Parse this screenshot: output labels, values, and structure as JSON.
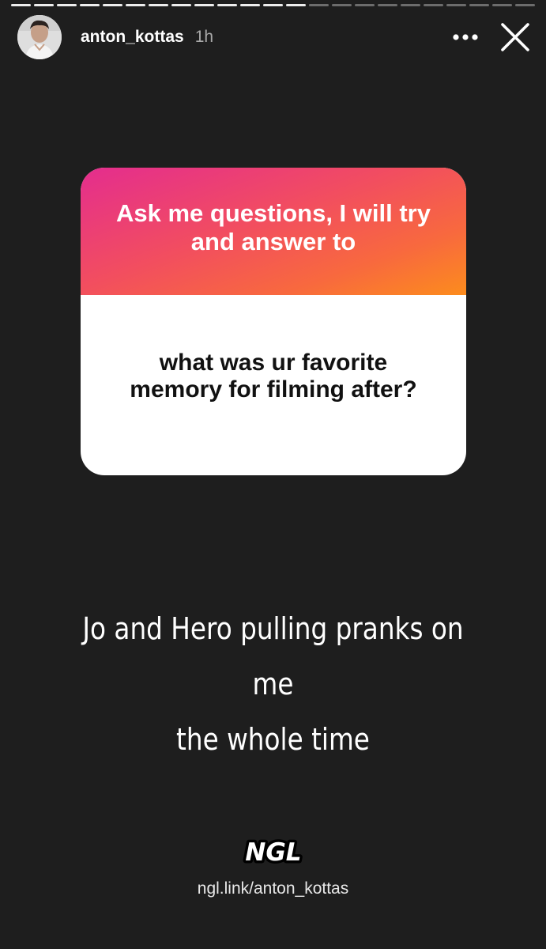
{
  "story": {
    "progress": {
      "total_segments": 23,
      "completed_segments": 13
    }
  },
  "header": {
    "username": "anton_kottas",
    "time": "1h",
    "more_icon": "more-horizontal-icon",
    "close_icon": "close-icon"
  },
  "question_sticker": {
    "prompt": "Ask me questions, I will try and answer to",
    "question": "what was ur favorite memory for filming after?"
  },
  "answer": {
    "line1": "Jo and Hero pulling pranks on me",
    "line2": "the whole time"
  },
  "footer": {
    "logo_text": "NGL",
    "link": "ngl.link/anton_kottas"
  },
  "colors": {
    "background": "#1e1e1e",
    "gradient_start": "#e42d8e",
    "gradient_end": "#fc8c1d"
  }
}
